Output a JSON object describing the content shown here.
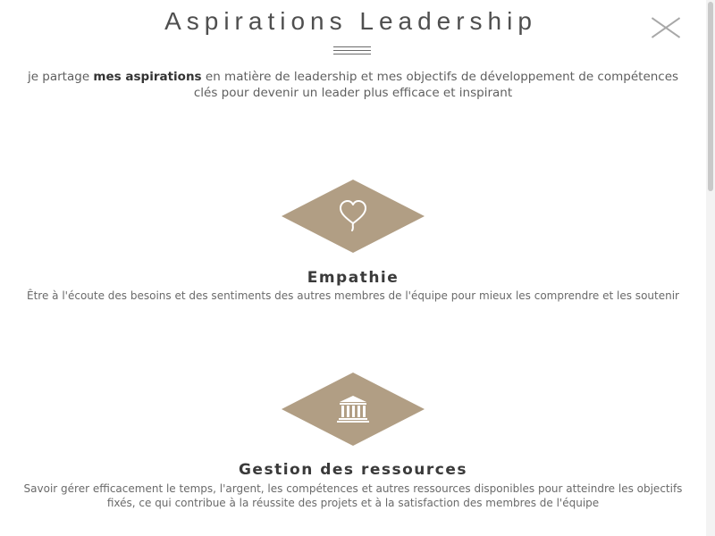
{
  "header": {
    "title": "Aspirations Leadership",
    "close_icon": "close-icon"
  },
  "intro": {
    "text_before": "je partage ",
    "text_bold": "mes aspirations",
    "text_after": " en matière de leadership et mes objectifs de développement de compétences clés pour devenir un leader plus efficace et inspirant"
  },
  "features": [
    {
      "icon": "heart-balloon-icon",
      "title": "Empathie",
      "description": "Être à l'écoute des besoins et des sentiments des autres membres de l'équipe pour mieux les comprendre et les soutenir"
    },
    {
      "icon": "bank-building-icon",
      "title": "Gestion des ressources",
      "description": "Savoir gérer efficacement le temps, l'argent, les compétences et autres ressources disponibles pour atteindre les objectifs fixés, ce qui contribue à la réussite des projets et à la satisfaction des membres de l'équipe"
    }
  ],
  "colors": {
    "accent": "#b19e84",
    "title_text": "#4f4f4f"
  }
}
